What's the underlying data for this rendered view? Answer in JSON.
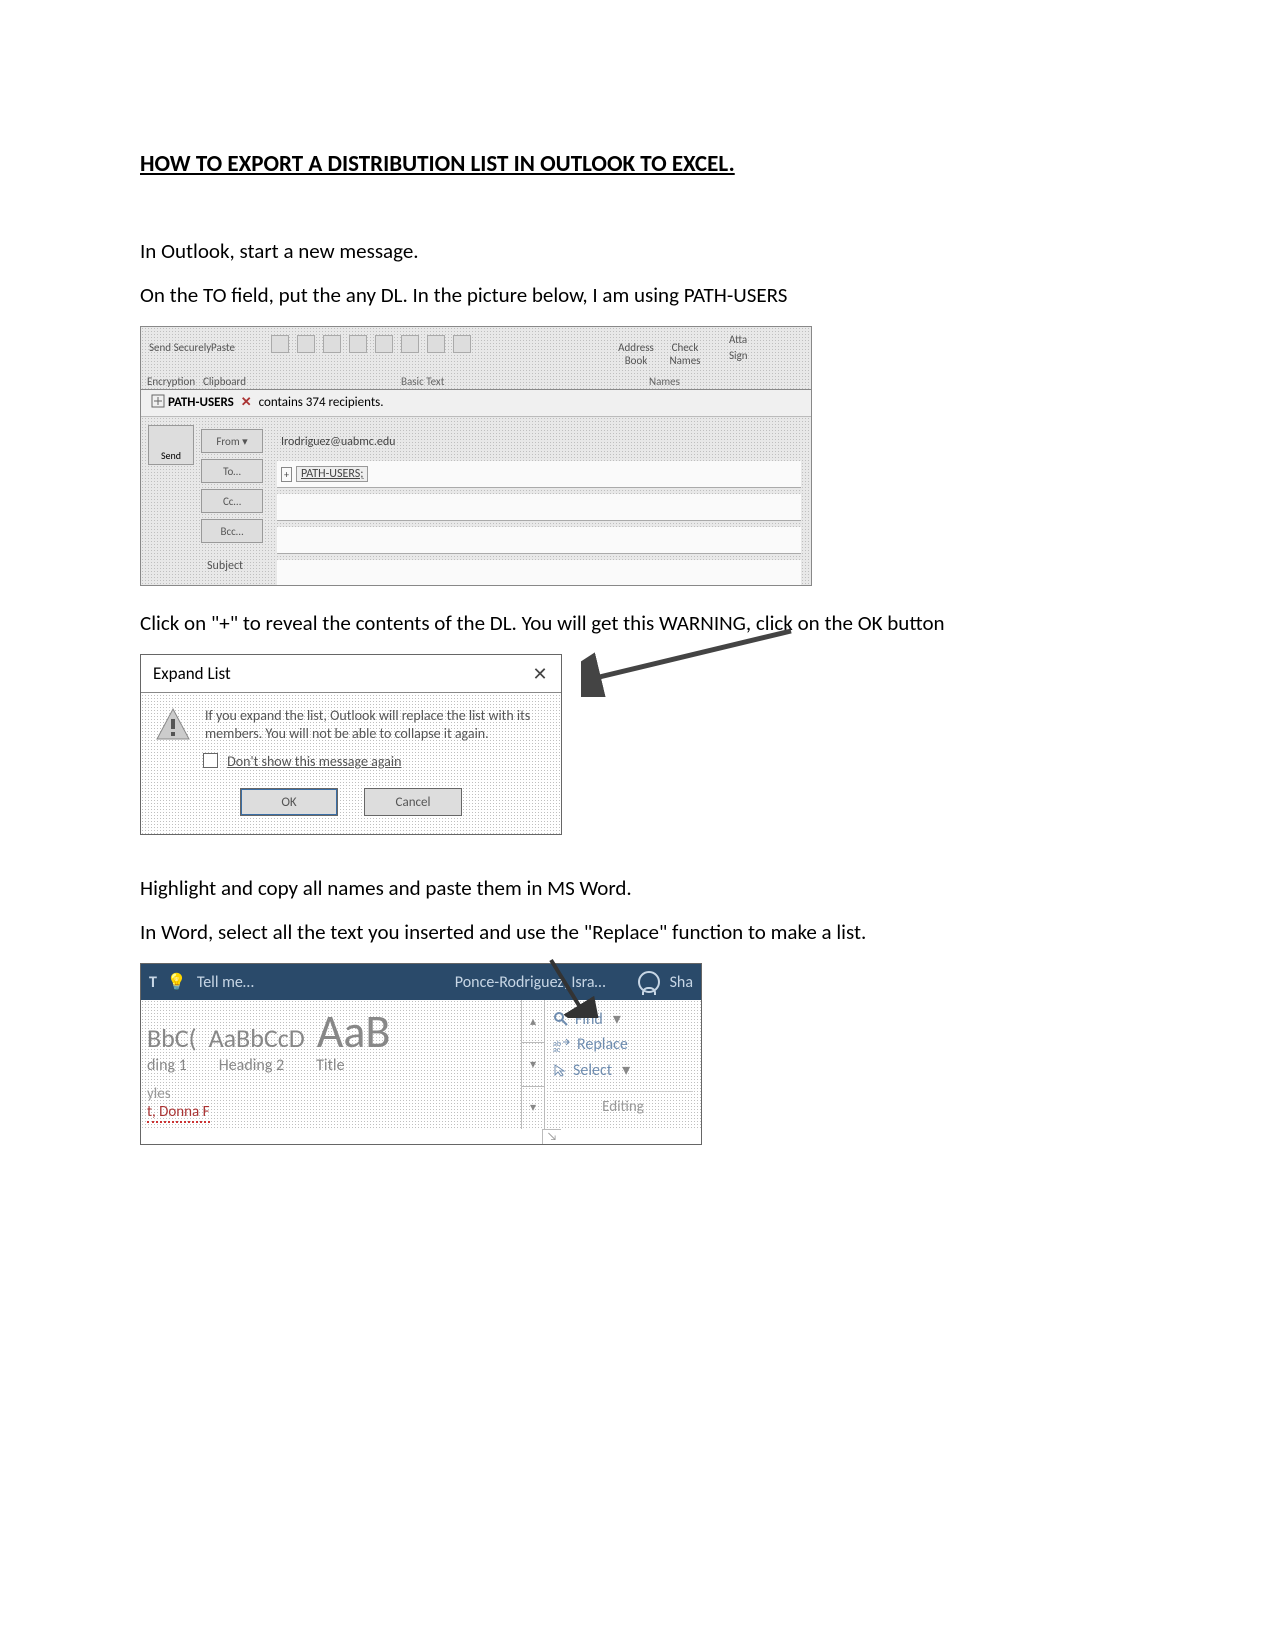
{
  "doc": {
    "title": "HOW TO EXPORT A DISTRIBUTION LIST IN OUTLOOK TO EXCEL.",
    "p1": "In Outlook, start a new message.",
    "p2": "On the TO field, put the any DL. In the picture below, I am using PATH-USERS",
    "p3": "Click on \"+\" to reveal the contents of the DL. You will get this WARNING, click on the OK button",
    "p4": "Highlight and copy all names and paste them in MS Word.",
    "p5": "In Word, select all the text you inserted and use the \"Replace\" function to make a list."
  },
  "outlook": {
    "ribbon": {
      "send_securely": "Send Securely",
      "encryption": "Encryption",
      "paste": "Paste",
      "clipboard": "Clipboard",
      "basic_text": "Basic Text",
      "address_book": "Address Book",
      "check_names": "Check Names",
      "names": "Names",
      "atta": "Atta",
      "sign": "Sign"
    },
    "dl_bar": {
      "name": "PATH-USERS",
      "remove_icon": "✕",
      "info": "contains 374 recipients."
    },
    "fields": {
      "send": "Send",
      "from": "From ▾",
      "to": "To…",
      "cc": "Cc…",
      "bcc": "Bcc…",
      "subject": "Subject",
      "from_value": "Irodriguez@uabmc.edu",
      "to_value": "PATH-USERS;"
    }
  },
  "expand_dialog": {
    "title": "Expand List",
    "close": "✕",
    "message": "If you expand the list, Outlook will replace the list with its members. You will not be able to collapse it again.",
    "checkbox": "Don't show this message again",
    "ok": "OK",
    "cancel": "Cancel"
  },
  "word": {
    "titlebar": {
      "tell_me": "Tell me…",
      "user": "Ponce-Rodriguez, Isra…",
      "share": "Sha"
    },
    "styles": {
      "s1": "BbC(",
      "s2": "AaBbCcD",
      "s3": "AaB",
      "l1": "ding 1",
      "l2": "Heading 2",
      "l3": "Title",
      "group": "yles",
      "doc_text": "t, Donna F"
    },
    "editing": {
      "find": "Find",
      "replace": "Replace",
      "select": "Select",
      "group": "Editing"
    }
  }
}
